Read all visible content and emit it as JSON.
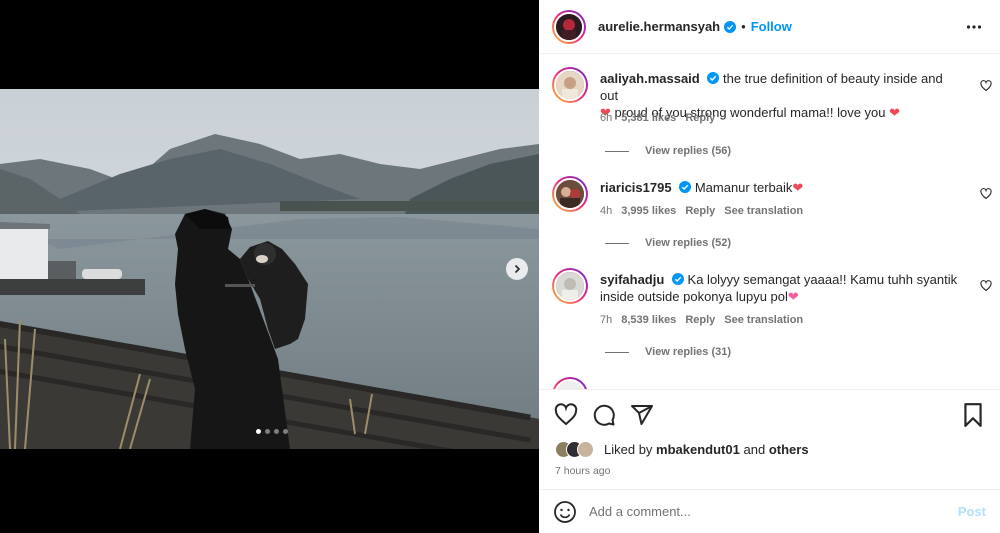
{
  "post": {
    "username": "aurelie.hermansyah",
    "follow_label": "Follow",
    "separator": "•",
    "carousel": {
      "slides": 4,
      "active_index": 0
    }
  },
  "comments": [
    {
      "username": "aaliyah.massaid",
      "text": "the true definition of beauty inside and out",
      "text2": "proud of you strong wonderful mama!! love you",
      "time": "6h",
      "likes": "5,381 likes",
      "reply": "Reply",
      "view_replies": "View replies (56)"
    },
    {
      "username": "riaricis1795",
      "text": "Mamanur terbaik",
      "time": "4h",
      "likes": "3,995 likes",
      "reply": "Reply",
      "translate": "See translation",
      "view_replies": "View replies (52)"
    },
    {
      "username": "syifahadju",
      "text": "Ka lolyyy semangat yaaaa!! Kamu tuhh syantik",
      "text2": "inside outside pokonya lupyu pol",
      "time": "7h",
      "likes": "8,539 likes",
      "reply": "Reply",
      "translate": "See translation",
      "view_replies": "View replies (31)"
    }
  ],
  "likes_summary": {
    "prefix": "Liked by",
    "user": "mbakendut01",
    "conj": "and",
    "others": "others"
  },
  "time_ago": "7 hours ago",
  "comment_box": {
    "placeholder": "Add a comment...",
    "post_label": "Post"
  },
  "colors": {
    "accent": "#0095f6",
    "like_red": "#ed4956",
    "post_disabled": "#b2dffc",
    "muted": "#737373"
  },
  "icons": [
    "verified-badge-icon",
    "more-options-icon",
    "heart-icon",
    "comment-icon",
    "share-icon",
    "bookmark-icon",
    "emoji-icon",
    "chevron-right-icon"
  ]
}
